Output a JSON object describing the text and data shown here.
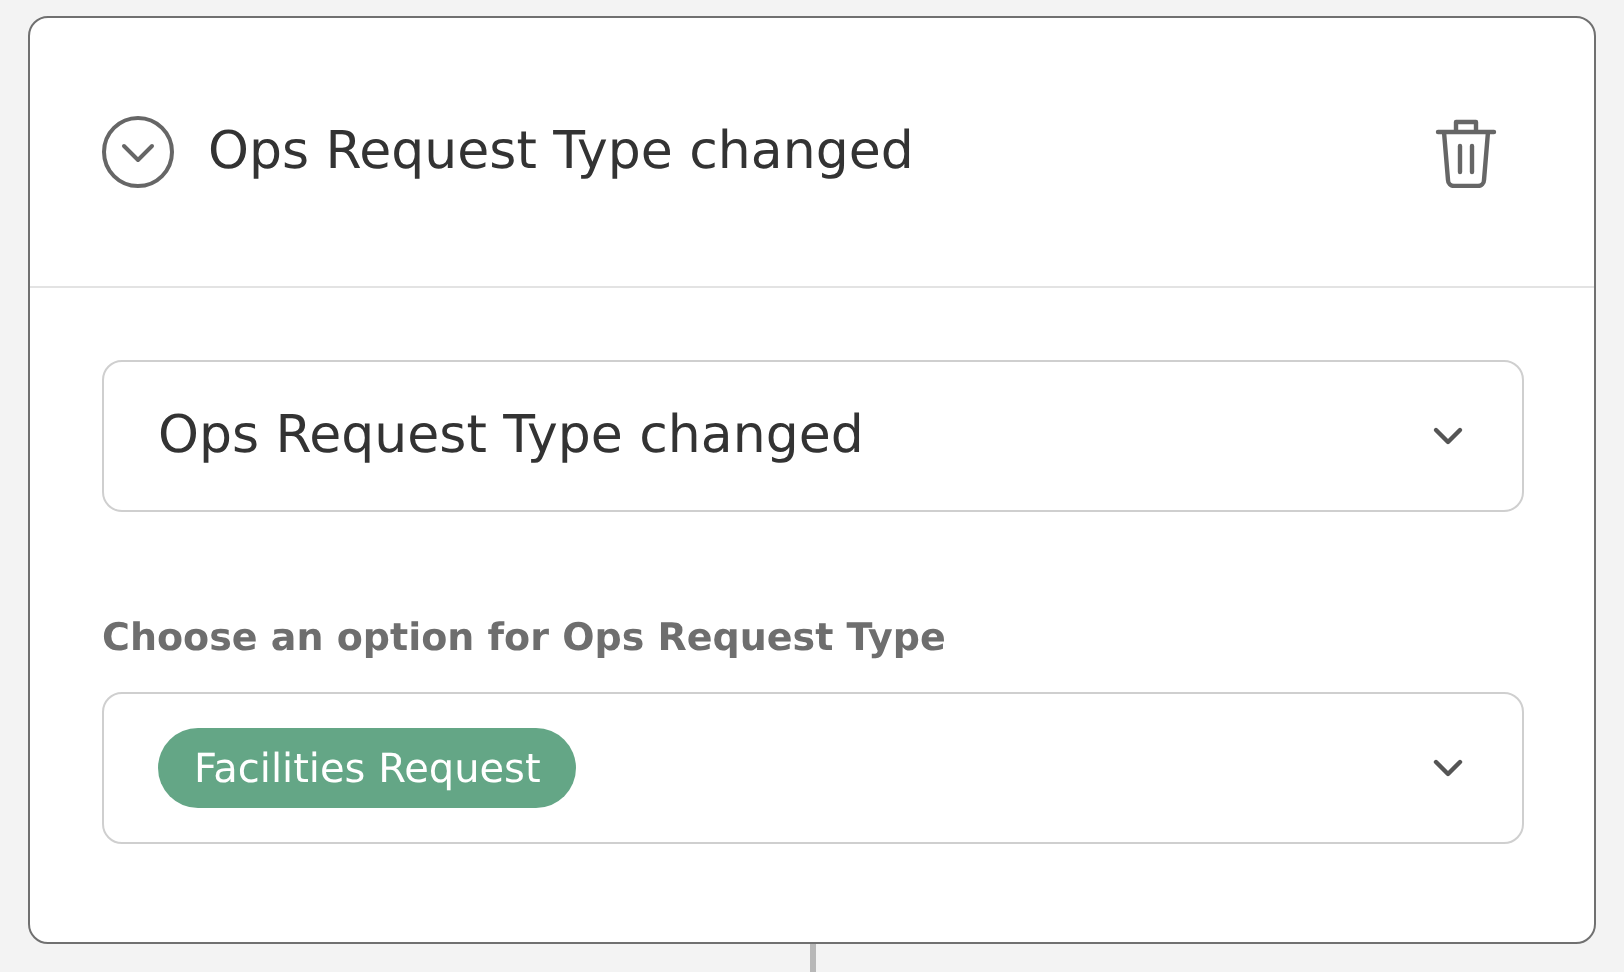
{
  "trigger": {
    "title": "Ops Request Type changed",
    "expanded": true
  },
  "event_select": {
    "value": "Ops Request Type changed"
  },
  "option_field": {
    "label": "Choose an option for Ops Request Type",
    "tags": [
      {
        "label": "Facilities Request",
        "color": "#64a686"
      }
    ]
  }
}
